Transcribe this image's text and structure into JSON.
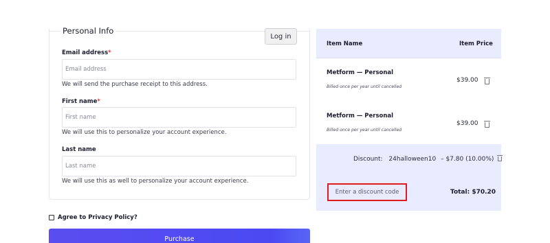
{
  "personal_info": {
    "title": "Personal Info",
    "login_label": "Log in",
    "fields": [
      {
        "label": "Email address",
        "required": "*",
        "placeholder": "Email address",
        "help": "We will send the purchase receipt to this address."
      },
      {
        "label": "First name",
        "required": "*",
        "placeholder": "First name",
        "help": "We will use this to personalize your account experience."
      },
      {
        "label": "Last name",
        "required": "",
        "placeholder": "Last name",
        "help": "We will use this as well to personalize your account experience."
      }
    ]
  },
  "agree": {
    "label": "Agree to Privacy Policy?",
    "checked": false
  },
  "purchase": {
    "label": "Purchase"
  },
  "cart": {
    "col_name": "Item Name",
    "col_price": "Item Price",
    "items": [
      {
        "name": "Metform — Personal",
        "note": "Billed once per year until cancelled",
        "price": "$39.00"
      },
      {
        "name": "Metform — Personal",
        "note": "Billed once per year until cancelled",
        "price": "$39.00"
      }
    ],
    "discount_label": "Discount:",
    "discount_code": "24halloween10",
    "discount_amount": "– $7.80 (10.00%)",
    "code_placeholder": "Enter a discount code",
    "total": "Total: $70.20"
  },
  "colors": {
    "accent": "#4a49f2",
    "cart_bg": "#e9ebff",
    "highlight": "#e11a22",
    "required": "#e0333f"
  }
}
